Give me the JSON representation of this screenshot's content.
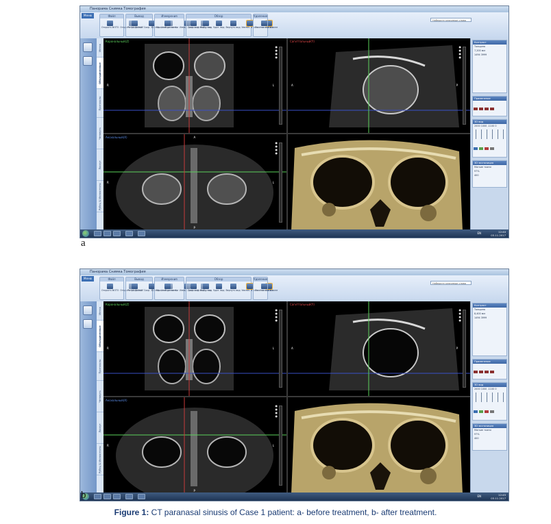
{
  "figure": {
    "caption_label": "Figure 1:",
    "caption_text": " CT paranasal sinusis of Case 1 patient: a- before treatment, b- after treatment.",
    "colors": {
      "caption": "#1a3b73",
      "ribbon": "#c7d8ee",
      "accent": "#3e68a6"
    }
  },
  "panels": [
    {
      "letter": "a",
      "window_title": "Панорама Снимка Томография",
      "search_placeholder": "Наберите ключевые слова",
      "menu_label": "Меню",
      "groups": [
        {
          "label": "Файл",
          "tools": [
            "Открыть ФОТО",
            "Открыть ФОСКОНЕТ"
          ]
        },
        {
          "label": "Вывод",
          "tools": [
            "Ретро-фильм",
            "Сохр. 3D мод.",
            "Экспорт. шаб."
          ]
        },
        {
          "label": "Измерения",
          "tools": [
            "Масштаб разметки",
            "Измер. длины",
            "Измер. угла"
          ]
        },
        {
          "label": "Обзор",
          "tools": [
            "Сохр. вид",
            "Выбр. вид",
            "Удал. вид",
            "Вернуть вид",
            "Увелич. в окне",
            "Уменьш. в окне"
          ]
        },
        {
          "label": "Удаление",
          "tools": [
            "Лиса на снимке"
          ]
        }
      ],
      "vertical_tabs": [
        "Метка",
        "Объединенные",
        "Протоколы",
        "Четверть",
        "Лоскут",
        "Рубец & Имплантаты"
      ],
      "active_tab_index": 1,
      "views": {
        "top_left": {
          "label": "Корональный(Z)",
          "label_color": "#5cd35c",
          "left": "R",
          "right": "L",
          "top": "",
          "bottom": ""
        },
        "top_right": {
          "label": "Сагиттальный(Y)",
          "label_color": "#e04646",
          "left": "A",
          "right": "P",
          "top": "",
          "bottom": ""
        },
        "bottom_left": {
          "label": "Аксиальный(X)",
          "label_color": "#5a8be6",
          "left": "R",
          "right": "L",
          "top": "A",
          "bottom": "P"
        },
        "bottom_right": {
          "label": "",
          "label_color": "#ffffff",
          "left": "",
          "right": "",
          "top": "",
          "bottom": ""
        }
      },
      "side_panels": [
        {
          "title": "Контраст",
          "lines": [
            "Толщина",
            "7,200 мм",
            "1494  3999"
          ]
        },
        {
          "title": "Применение",
          "lines": []
        },
        {
          "title": "3D вид",
          "lines": [
            "2000  1000  -1100  0"
          ]
        },
        {
          "title": "3D экспозиция",
          "lines": [
            "Мягкие ткани",
            "97%",
            "400"
          ]
        }
      ],
      "taskbar": {
        "lang": "EN",
        "time": "12:40",
        "date": "03.11.2017"
      }
    },
    {
      "letter": "b",
      "window_title": "Панорама Снимка Томография",
      "search_placeholder": "Наберите ключевые слова",
      "menu_label": "Меню",
      "groups": [
        {
          "label": "Файл",
          "tools": [
            "Открыть ФОТО",
            "Открыть ФОСКОНЕТ"
          ]
        },
        {
          "label": "Вывод",
          "tools": [
            "Ретро-фильм",
            "Сохр. 3D мод.",
            "Экспорт. шаб."
          ]
        },
        {
          "label": "Измерения",
          "tools": [
            "Масштаб разметки",
            "Измер. длины",
            "Измер. угла"
          ]
        },
        {
          "label": "Обзор",
          "tools": [
            "Сохр. вид",
            "Выбр. вид",
            "Удал. вид",
            "Вернуть вид",
            "Увелич. в окне",
            "Уменьш. в окне"
          ]
        },
        {
          "label": "Удаление",
          "tools": [
            "Лиса на снимке"
          ]
        }
      ],
      "vertical_tabs": [
        "Метка",
        "Объединенные",
        "Протоколы",
        "Четверть",
        "Лоскут",
        "Рубец & Имплантаты"
      ],
      "active_tab_index": 1,
      "views": {
        "top_left": {
          "label": "Корональный(Z)",
          "label_color": "#5cd35c",
          "left": "R",
          "right": "L",
          "top": "",
          "bottom": ""
        },
        "top_right": {
          "label": "Сагиттальный(Y)",
          "label_color": "#e04646",
          "left": "A",
          "right": "P",
          "top": "",
          "bottom": ""
        },
        "bottom_left": {
          "label": "Аксиальный(X)",
          "label_color": "#5a8be6",
          "left": "R",
          "right": "L",
          "top": "",
          "bottom": "P"
        },
        "bottom_right": {
          "label": "",
          "label_color": "#ffffff",
          "left": "",
          "right": "",
          "top": "",
          "bottom": ""
        }
      },
      "side_panels": [
        {
          "title": "Контраст",
          "lines": [
            "Толщина",
            "8,400 мм",
            "1494  3999"
          ]
        },
        {
          "title": "Применение",
          "lines": []
        },
        {
          "title": "3D вид",
          "lines": [
            "2000  1000  -1100  0"
          ]
        },
        {
          "title": "3D экспозиция",
          "lines": [
            "Мягкие ткани",
            "97%",
            "400"
          ]
        }
      ],
      "taskbar": {
        "lang": "EN",
        "time": "12:45",
        "date": "03.11.2017"
      }
    }
  ]
}
